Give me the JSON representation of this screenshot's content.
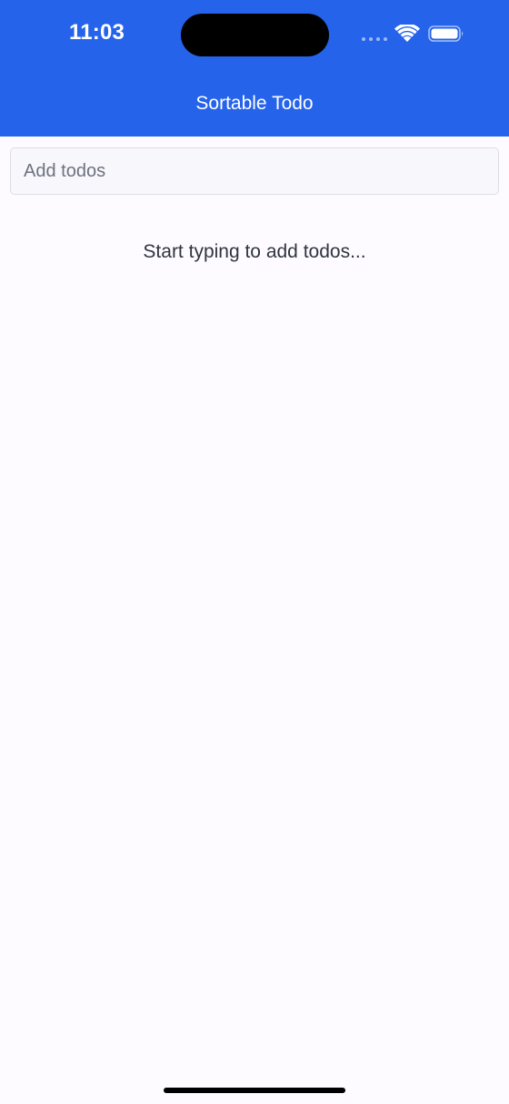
{
  "status_bar": {
    "time": "11:03",
    "signal_icon": "cellular-signal-icon",
    "wifi_icon": "wifi-icon",
    "battery_icon": "battery-icon"
  },
  "header": {
    "title": "Sortable Todo",
    "background_color": "#2563eb"
  },
  "todo_input": {
    "value": "",
    "placeholder": "Add todos"
  },
  "empty_state": {
    "message": "Start typing to add todos..."
  },
  "colors": {
    "accent": "#2563eb",
    "page_background": "#fdfbff"
  }
}
